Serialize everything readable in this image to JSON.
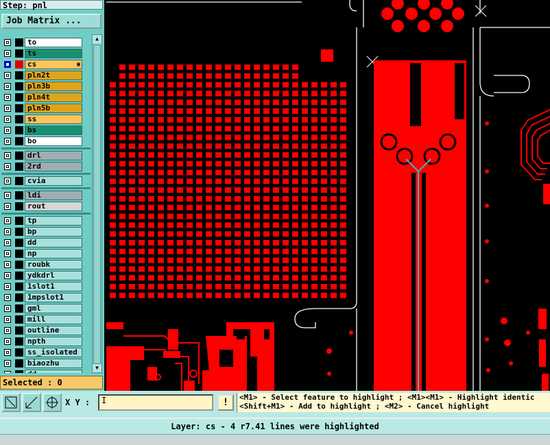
{
  "panel": {
    "step": "Step: pnl",
    "job_matrix_label": "Job Matrix ...",
    "selected": "Selected : 0"
  },
  "layers": [
    {
      "name": "to",
      "bg": "#ffffff",
      "swatch": "#000000",
      "checked": false,
      "group": 0
    },
    {
      "name": "ts",
      "bg": "#1b8f73",
      "swatch": "#000000",
      "checked": false,
      "group": 0
    },
    {
      "name": "cs",
      "bg": "#ffc35a",
      "swatch": "#e00000",
      "checked": true,
      "group": 0,
      "marked": true
    },
    {
      "name": "pln2t",
      "bg": "#e0a41c",
      "swatch": "#000000",
      "checked": false,
      "group": 0
    },
    {
      "name": "pln3b",
      "bg": "#e0a41c",
      "swatch": "#000000",
      "checked": false,
      "group": 0
    },
    {
      "name": "pln4t",
      "bg": "#e0a41c",
      "swatch": "#000000",
      "checked": false,
      "group": 0
    },
    {
      "name": "pln5b",
      "bg": "#e0a41c",
      "swatch": "#000000",
      "checked": false,
      "group": 0
    },
    {
      "name": "ss",
      "bg": "#ffc35a",
      "swatch": "#000000",
      "checked": false,
      "group": 0
    },
    {
      "name": "bs",
      "bg": "#1b8f73",
      "swatch": "#000000",
      "checked": false,
      "group": 0
    },
    {
      "name": "bo",
      "bg": "#ffffff",
      "swatch": "#000000",
      "checked": false,
      "group": 0
    },
    {
      "name": "drl",
      "bg": "#9eaeb4",
      "swatch": "#000000",
      "checked": false,
      "group": 1
    },
    {
      "name": "2rd",
      "bg": "#9eaeb4",
      "swatch": "#000000",
      "checked": false,
      "group": 1
    },
    {
      "name": "cvia",
      "bg": "#a8e0dc",
      "swatch": "#000000",
      "checked": false,
      "group": 2
    },
    {
      "name": "ldi",
      "bg": "#9eaeb4",
      "swatch": "#000000",
      "checked": false,
      "group": 3
    },
    {
      "name": "rout",
      "bg": "#d6d6d6",
      "swatch": "#000000",
      "checked": false,
      "group": 3
    },
    {
      "name": "tp",
      "bg": "#a8e0dc",
      "swatch": "#000000",
      "checked": false,
      "group": 4
    },
    {
      "name": "bp",
      "bg": "#a8e0dc",
      "swatch": "#000000",
      "checked": false,
      "group": 4
    },
    {
      "name": "dd",
      "bg": "#a8e0dc",
      "swatch": "#000000",
      "checked": false,
      "group": 4
    },
    {
      "name": "np",
      "bg": "#a8e0dc",
      "swatch": "#000000",
      "checked": false,
      "group": 4
    },
    {
      "name": "roubk",
      "bg": "#a8e0dc",
      "swatch": "#000000",
      "checked": false,
      "group": 4
    },
    {
      "name": "ydkdrl",
      "bg": "#a8e0dc",
      "swatch": "#000000",
      "checked": false,
      "group": 4
    },
    {
      "name": "1slot1",
      "bg": "#a8e0dc",
      "swatch": "#000000",
      "checked": false,
      "group": 4
    },
    {
      "name": "1mpslot1",
      "bg": "#a8e0dc",
      "swatch": "#000000",
      "checked": false,
      "group": 4
    },
    {
      "name": "gml",
      "bg": "#a8e0dc",
      "swatch": "#000000",
      "checked": false,
      "group": 4
    },
    {
      "name": "mill",
      "bg": "#a8e0dc",
      "swatch": "#000000",
      "checked": false,
      "group": 4
    },
    {
      "name": "outline",
      "bg": "#a8e0dc",
      "swatch": "#000000",
      "checked": false,
      "group": 4
    },
    {
      "name": "npth",
      "bg": "#a8e0dc",
      "swatch": "#000000",
      "checked": false,
      "group": 4
    },
    {
      "name": "ss_isolated",
      "bg": "#a8e0dc",
      "swatch": "#000000",
      "checked": false,
      "group": 4
    },
    {
      "name": "biaozhu",
      "bg": "#a8e0dc",
      "swatch": "#000000",
      "checked": false,
      "group": 4
    },
    {
      "name": "dd",
      "bg": "#a8e0dc",
      "swatch": "#000000",
      "checked": false,
      "group": 4
    }
  ],
  "toolbar": {
    "xy_label": "X Y :",
    "xy_value": "I",
    "excl": "!"
  },
  "hint": {
    "line1": "<M1> - Select feature to highlight ; <M1><M1> - Highlight identic",
    "line2": "<Shift+M1> - Add to highlight ; <M2> - Cancel highlight"
  },
  "status": "Layer: cs - 4 r7.41 lines were highlighted",
  "colors": {
    "copper": "#ff0000",
    "board": "#000000",
    "outline": "#ffffff",
    "trace": "#36b7c4"
  }
}
